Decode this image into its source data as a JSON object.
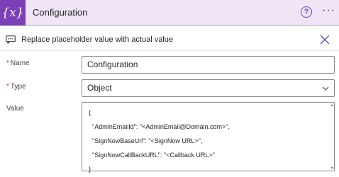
{
  "header": {
    "icon_text": "{x}",
    "title": "Configuration",
    "help_label": "?",
    "more_label": "···"
  },
  "tip": {
    "text": "Replace placeholder value with actual value"
  },
  "fields": {
    "name": {
      "label": "Name",
      "required_mark": "*",
      "value": "Configuration"
    },
    "type": {
      "label": "Type",
      "required_mark": "*",
      "value": "Object"
    },
    "value": {
      "label": "Value",
      "lines": [
        "{",
        "  \"AdminEmailId\": \"<AdminEmail@Domain.com>\",",
        "  \"SignNowBaseUrl\": \"<SignNow URL>\",",
        "  \"SignNowCallBackURL\": \"<Callback URL>\"",
        "}"
      ]
    }
  },
  "colors": {
    "accent": "#7b3fb6",
    "header_bg": "#f0e4f7",
    "link_blue": "#5f52b8",
    "required_red": "#c4314b"
  },
  "icons": {
    "header": "curly-x-variable-icon",
    "help": "help-circle-icon",
    "more": "more-ellipsis-icon",
    "tip": "comment-icon",
    "close": "close-icon",
    "dropdown": "chevron-down-icon"
  }
}
